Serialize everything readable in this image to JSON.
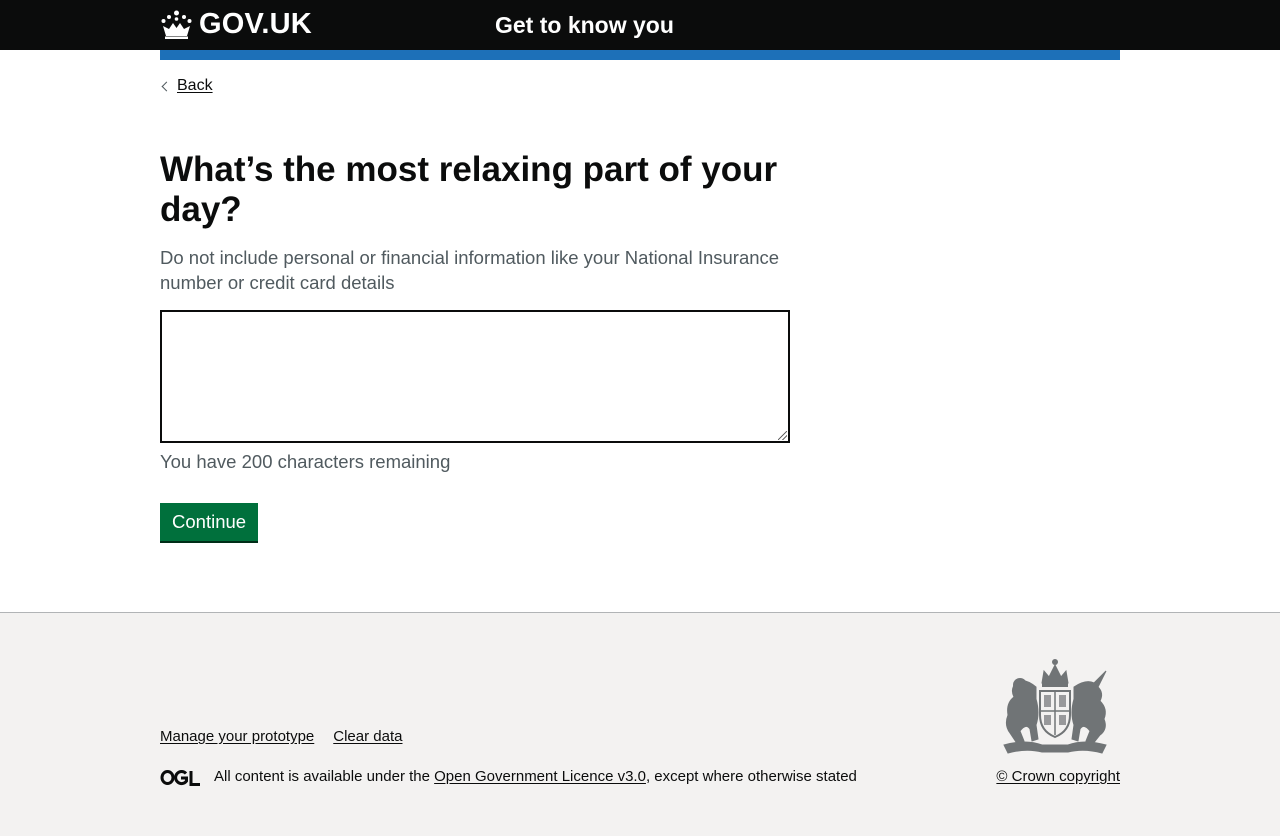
{
  "header": {
    "logo_text": "GOV.UK",
    "service_name": "Get to know you"
  },
  "nav": {
    "back_label": "Back"
  },
  "question": {
    "heading": "What’s the most relaxing part of your day?",
    "hint": "Do not include personal or financial information like your National Insurance number or credit card details",
    "textarea_value": "",
    "character_count_message": "You have 200 characters remaining"
  },
  "actions": {
    "continue_label": "Continue"
  },
  "footer": {
    "links": [
      "Manage your prototype",
      "Clear data"
    ],
    "licence_prefix": "All content is available under the ",
    "licence_link": "Open Government Licence v3.0",
    "licence_suffix": ", except where otherwise stated",
    "copyright": "© Crown copyright"
  },
  "colors": {
    "header_bg": "#0b0c0c",
    "brand_bar": "#1d70b8",
    "button_green": "#00703c",
    "footer_bg": "#f3f2f1",
    "secondary_text": "#505a5f"
  },
  "icons": [
    "crown-icon",
    "chevron-left-icon",
    "ogl-logo-icon",
    "royal-coat-of-arms-icon"
  ]
}
